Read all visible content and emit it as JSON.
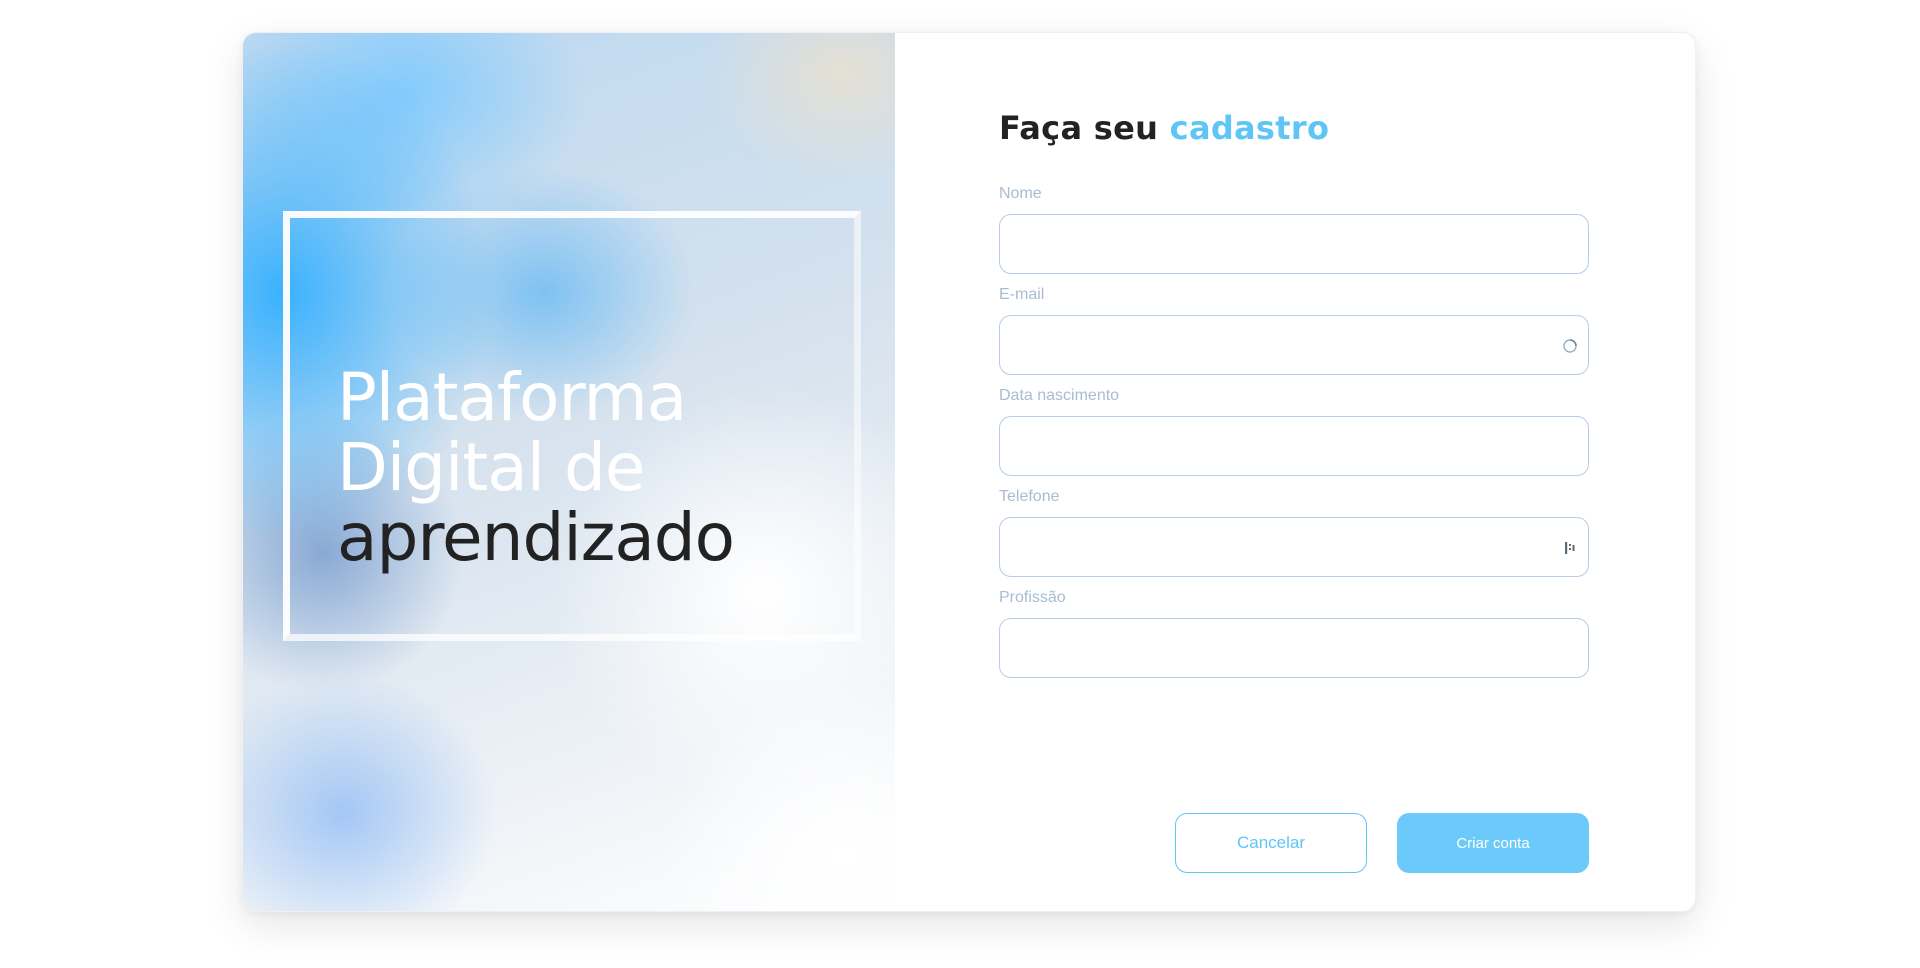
{
  "hero": {
    "line1": "Plataforma",
    "line2": "Digital de",
    "line3": "aprendizado"
  },
  "form": {
    "title_prefix": "Faça seu",
    "title_accent": "cadastro",
    "fields": [
      {
        "label": "Nome",
        "value": ""
      },
      {
        "label": "E-mail",
        "value": "",
        "icon": "loading-circle-icon"
      },
      {
        "label": "Data nascimento",
        "value": ""
      },
      {
        "label": "Telefone",
        "value": "",
        "icon": "keypad-icon"
      },
      {
        "label": "Profissão",
        "value": ""
      }
    ],
    "cancel_label": "Cancelar",
    "submit_label": "Criar conta"
  },
  "colors": {
    "accent": "#5ec5f7",
    "button_bg": "#6ccafa",
    "label": "#a9bcd2",
    "input_border": "#b6cde4",
    "title": "#222222"
  }
}
